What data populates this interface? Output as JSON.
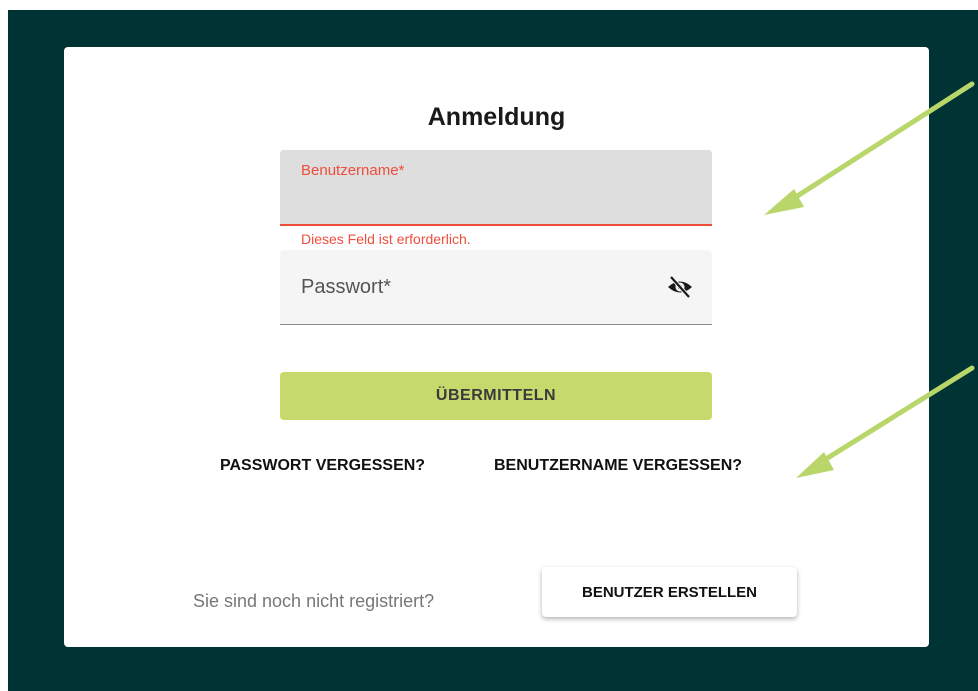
{
  "form": {
    "title": "Anmeldung",
    "username": {
      "label": "Benutzername*",
      "value": "",
      "error": "Dieses Feld ist erforderlich."
    },
    "password": {
      "label": "Passwort*",
      "value": "",
      "visibility_icon": "eye-off-icon"
    },
    "submit_label": "ÜBERMITTELN"
  },
  "links": {
    "forgot_password": "PASSWORT VERGESSEN?",
    "forgot_username": "BENUTZERNAME VERGESSEN?"
  },
  "register": {
    "prompt": "Sie sind noch nicht registriert?",
    "button_label": "BENUTZER ERSTELLEN"
  },
  "colors": {
    "background": "#003333",
    "accent": "#c6d96d",
    "error": "#f04d3c",
    "annotation_arrow": "#b8d66a"
  }
}
